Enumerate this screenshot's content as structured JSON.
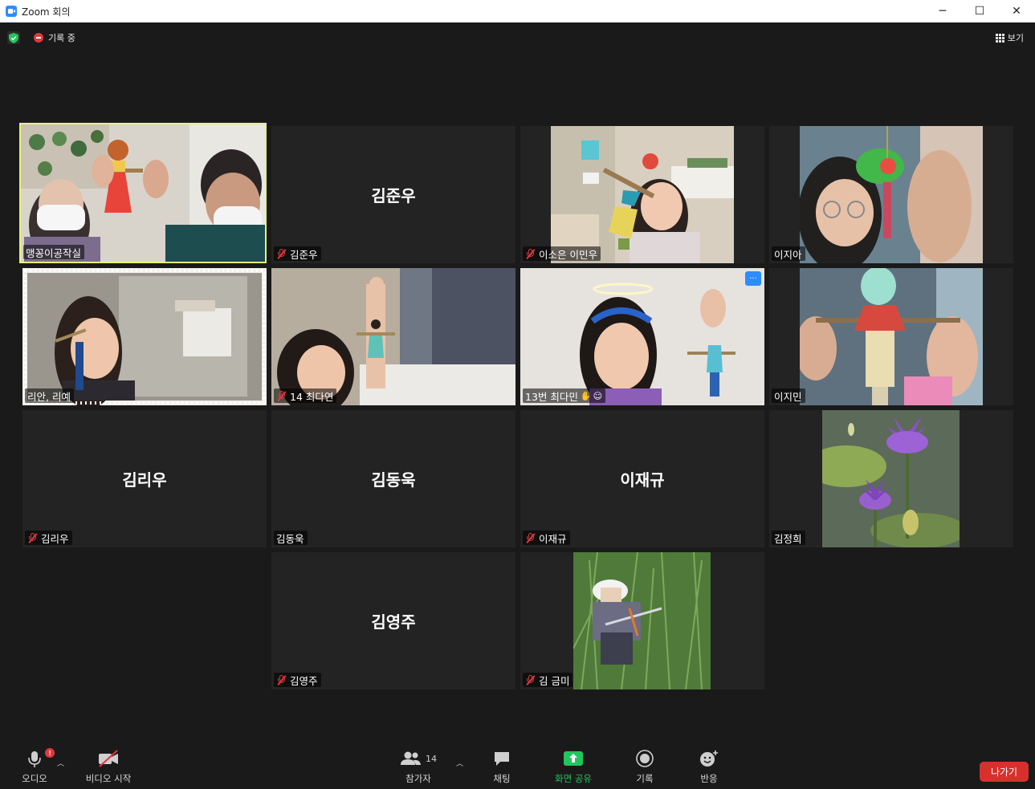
{
  "window": {
    "title": "Zoom 회의",
    "controls": [
      "─",
      "☐",
      "✕"
    ]
  },
  "top_bar": {
    "recording_label": "기록 중",
    "view_label": "보기"
  },
  "participants": [
    {
      "name": "맹꽁이공작실",
      "video": true,
      "muted": false,
      "active_speaker": true
    },
    {
      "name": "김준우",
      "video": false,
      "muted": true
    },
    {
      "name": "이소은 이민우",
      "video": true,
      "muted": true
    },
    {
      "name": "이지아",
      "video": true,
      "muted": false
    },
    {
      "name": "리안, 리예",
      "video": true,
      "muted": false
    },
    {
      "name": "14 최다연",
      "video": true,
      "muted": true
    },
    {
      "name": "13번 최다민",
      "video": true,
      "muted": false
    },
    {
      "name": "이지민",
      "video": true,
      "muted": false
    },
    {
      "name": "김리우",
      "video": false,
      "muted": true
    },
    {
      "name": "김동욱",
      "video": false,
      "muted": false
    },
    {
      "name": "이재규",
      "video": false,
      "muted": true
    },
    {
      "name": "김정희",
      "video": true,
      "muted": false
    },
    {
      "name": "김영주",
      "video": false,
      "muted": true
    },
    {
      "name": "김 금미",
      "video": true,
      "muted": true
    }
  ],
  "more_button": "···",
  "toolbar": {
    "audio_label": "오디오",
    "audio_alert_badge": "!",
    "video_label": "비디오 시작",
    "participants_label": "참가자",
    "participants_count": "14",
    "chat_label": "채팅",
    "share_label": "화면 공유",
    "record_label": "기록",
    "reactions_label": "반응",
    "leave_label": "나가기"
  },
  "colors": {
    "background": "#1a1a1a",
    "tile": "#232323",
    "active_border": "#e6f27a",
    "share_green": "#22c55e",
    "leave_red": "#d8302c",
    "mute_red": "#e0383e",
    "accent_blue": "#2d8cff"
  }
}
